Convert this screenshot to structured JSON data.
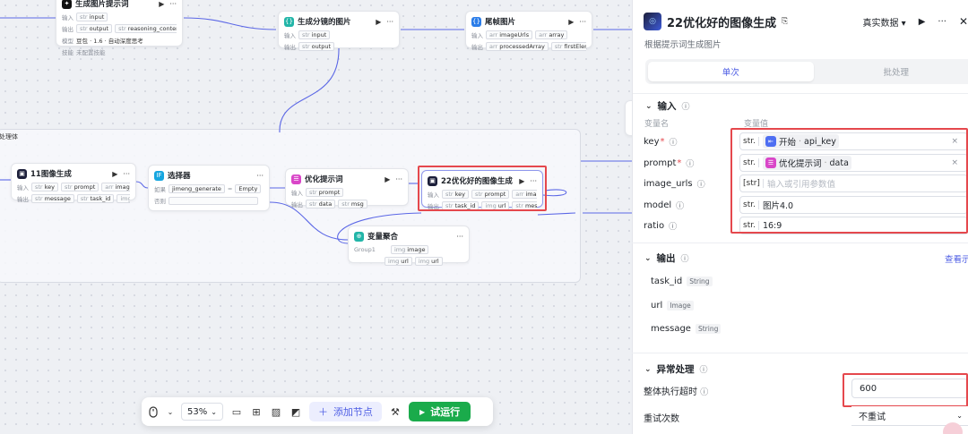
{
  "canvas": {
    "loop_label": "处理体",
    "nodes": {
      "top_left": {
        "title": "生成图片提示词",
        "row1_label": "输入",
        "row1_chips": [
          {
            "t": "str",
            "v": "input"
          }
        ],
        "row2_label": "输出",
        "row2_chips": [
          {
            "t": "str",
            "v": "output"
          },
          {
            "t": "str",
            "v": "reasoning_content"
          }
        ],
        "row3_label": "模型",
        "row3_text": "豆包 · 1.6 · 自动深度思考",
        "row4_label": "技能",
        "row4_text": "未配置技能"
      },
      "split": {
        "title": "生成分镜的图片",
        "row1_label": "输入",
        "row1_chips": [
          {
            "t": "str",
            "v": "input"
          }
        ],
        "row2_label": "输出",
        "row2_chips": [
          {
            "t": "str",
            "v": "output"
          }
        ]
      },
      "tail": {
        "title": "尾帧图片",
        "row1_label": "输入",
        "row1_chips": [
          {
            "t": "arr",
            "v": "imageUrls"
          },
          {
            "t": "arr",
            "v": "array"
          }
        ],
        "row2_label": "输出",
        "row2_chips": [
          {
            "t": "arr",
            "v": "processedArray"
          },
          {
            "t": "str",
            "v": "firstElementFullUrl"
          }
        ]
      },
      "img11": {
        "title": "11图像生成",
        "row1_label": "输入",
        "row1_chips": [
          {
            "t": "str",
            "v": "key"
          },
          {
            "t": "str",
            "v": "prompt"
          },
          {
            "t": "arr",
            "v": "image_urls"
          }
        ],
        "row2_label": "输出",
        "row2_chips": [
          {
            "t": "str",
            "v": "message"
          },
          {
            "t": "str",
            "v": "task_id"
          },
          {
            "t": "img",
            "v": "url"
          }
        ]
      },
      "selector": {
        "title": "选择器",
        "cond_label": "如果",
        "cond_left": "jimeng_generate",
        "cond_op": "=",
        "cond_right": "Empty",
        "else_label": "否则"
      },
      "optimize": {
        "title": "优化提示词",
        "row1_label": "输入",
        "row1_chips": [
          {
            "t": "str",
            "v": "prompt"
          }
        ],
        "row2_label": "输出",
        "row2_chips": [
          {
            "t": "str",
            "v": "data"
          },
          {
            "t": "str",
            "v": "msg"
          }
        ]
      },
      "img22": {
        "title": "22优化好的图像生成",
        "row1_label": "输入",
        "row1_chips": [
          {
            "t": "str",
            "v": "key"
          },
          {
            "t": "str",
            "v": "prompt"
          },
          {
            "t": "arr",
            "v": "image_urls"
          }
        ],
        "row2_label": "输出",
        "row2_chips": [
          {
            "t": "str",
            "v": "task_id"
          },
          {
            "t": "img",
            "v": "url"
          },
          {
            "t": "str",
            "v": "message"
          }
        ]
      },
      "merge": {
        "title": "变量聚合",
        "row_label": "Group1",
        "chip1": {
          "t": "img",
          "v": "image"
        },
        "chip2": {
          "t": "img",
          "v": "url"
        },
        "chip3": {
          "t": "img",
          "v": "url"
        }
      }
    }
  },
  "toolbar": {
    "zoom": "53%",
    "add_node": "添加节点",
    "run": "试运行"
  },
  "panel": {
    "title": "22优化好的图像生成",
    "subtitle": "根据提示词生成图片",
    "data_mode": "真实数据",
    "tabs": [
      "单次",
      "批处理"
    ],
    "input_section": "输入",
    "col_name": "变量名",
    "col_value": "变量值",
    "params": [
      {
        "name": "key",
        "required": true,
        "type": "str.",
        "ref_node": "开始",
        "ref_var": "api_key",
        "ref_color": "#4e6ef2",
        "clearable": true
      },
      {
        "name": "prompt",
        "required": true,
        "type": "str.",
        "ref_node": "优化提示词",
        "ref_var": "data",
        "ref_color": "#d946c8",
        "clearable": true
      },
      {
        "name": "image_urls",
        "required": false,
        "type": "[str]",
        "placeholder": "输入或引用参数值"
      },
      {
        "name": "model",
        "required": false,
        "type": "str.",
        "value": "图片4.0"
      },
      {
        "name": "ratio",
        "required": false,
        "type": "str.",
        "value": "16:9"
      }
    ],
    "output_section": "输出",
    "view_example": "查看示例",
    "outputs": [
      {
        "name": "task_id",
        "type": "String"
      },
      {
        "name": "url",
        "type": "Image"
      },
      {
        "name": "message",
        "type": "String"
      }
    ],
    "exception_section": "异常处理",
    "timeout_label": "整体执行超时",
    "timeout_value": "600",
    "retry_label": "重试次数",
    "retry_value": "不重试"
  },
  "colors": {
    "accent": "#4e5ee4",
    "run": "#1aab4b",
    "highlight": "#e5484d",
    "edge": "#5b67e6"
  }
}
